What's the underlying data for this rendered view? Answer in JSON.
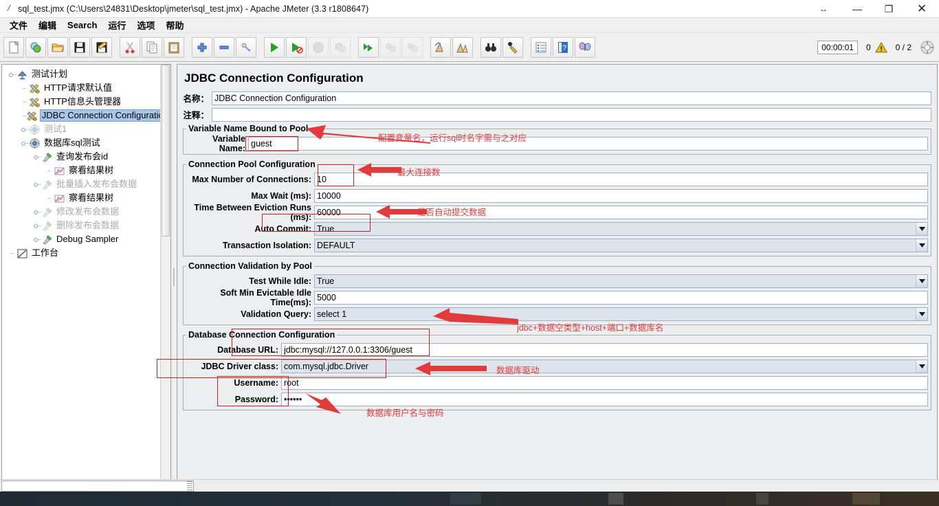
{
  "window": {
    "title": "sql_test.jmx (C:\\Users\\24831\\Desktop\\jmeter\\sql_test.jmx) - Apache JMeter (3.3 r1808647)",
    "app_icon": "jmeter-feather-icon",
    "controls": {
      "restore_arrows": "↔",
      "minimize": "—",
      "maximize": "❐",
      "close": "✕"
    }
  },
  "menubar": {
    "items": [
      {
        "label": "文件",
        "name": "menu-file"
      },
      {
        "label": "编辑",
        "name": "menu-edit"
      },
      {
        "label": "Search",
        "name": "menu-search"
      },
      {
        "label": "运行",
        "name": "menu-run"
      },
      {
        "label": "选项",
        "name": "menu-options"
      },
      {
        "label": "帮助",
        "name": "menu-help"
      }
    ]
  },
  "toolbar": {
    "buttons": [
      {
        "name": "new-button",
        "icon": "new-document-icon",
        "enabled": true
      },
      {
        "name": "templates-button",
        "icon": "templates-icon",
        "enabled": true
      },
      {
        "name": "open-button",
        "icon": "open-folder-icon",
        "enabled": true
      },
      {
        "name": "save-button",
        "icon": "floppy-save-icon",
        "enabled": true
      },
      {
        "name": "save-as-button",
        "icon": "save-as-icon",
        "enabled": true
      },
      {
        "name": "cut-button",
        "icon": "scissors-icon",
        "enabled": true
      },
      {
        "name": "copy-button",
        "icon": "copy-icon",
        "enabled": true
      },
      {
        "name": "paste-button",
        "icon": "clipboard-paste-icon",
        "enabled": true
      },
      {
        "name": "expand-all-button",
        "icon": "plus-icon",
        "enabled": true
      },
      {
        "name": "collapse-all-button",
        "icon": "minus-icon",
        "enabled": true
      },
      {
        "name": "toggle-button",
        "icon": "toggle-icon",
        "enabled": true
      },
      {
        "name": "start-button",
        "icon": "play-green-icon",
        "enabled": true
      },
      {
        "name": "start-no-pauses-button",
        "icon": "play-no-pause-icon",
        "enabled": true
      },
      {
        "name": "stop-button",
        "icon": "stop-octagon-icon",
        "enabled": false
      },
      {
        "name": "shutdown-button",
        "icon": "shutdown-icon",
        "enabled": false
      },
      {
        "name": "start-remote-button",
        "icon": "remote-start-icon",
        "enabled": true
      },
      {
        "name": "stop-remote-button",
        "icon": "remote-stop-icon",
        "enabled": false
      },
      {
        "name": "shutdown-remote-button",
        "icon": "remote-shutdown-icon",
        "enabled": false
      },
      {
        "name": "clear-button",
        "icon": "clear-broom-icon",
        "enabled": true
      },
      {
        "name": "clear-all-button",
        "icon": "clear-all-icon",
        "enabled": true
      },
      {
        "name": "search-button",
        "icon": "binoculars-icon",
        "enabled": true
      },
      {
        "name": "search-reset-button",
        "icon": "search-reset-icon",
        "enabled": true
      },
      {
        "name": "function-helper-button",
        "icon": "function-list-icon",
        "enabled": true
      },
      {
        "name": "help-button",
        "icon": "help-book-icon",
        "enabled": true
      },
      {
        "name": "undo-redo-button",
        "icon": "butterfly-icon",
        "enabled": true
      }
    ],
    "status": {
      "timer": "00:00:01",
      "error_count": "0",
      "warning_icon": "warning-triangle-icon",
      "threads": "0 / 2",
      "threads_icon": "threads-gear-icon"
    }
  },
  "tree": {
    "nodes": [
      {
        "label": "测试计划",
        "icon": "test-plan-icon",
        "depth": 0,
        "enabled": true,
        "selected": false,
        "expander": "expanded"
      },
      {
        "label": "HTTP请求默认值",
        "icon": "config-tools-icon",
        "depth": 1,
        "enabled": true,
        "selected": false,
        "expander": "none"
      },
      {
        "label": "HTTP信息头管理器",
        "icon": "config-tools-icon",
        "depth": 1,
        "enabled": true,
        "selected": false,
        "expander": "none"
      },
      {
        "label": "JDBC Connection Configuration",
        "icon": "config-tools-icon",
        "depth": 1,
        "enabled": true,
        "selected": true,
        "expander": "none"
      },
      {
        "label": "测试1",
        "icon": "thread-group-icon",
        "depth": 1,
        "enabled": false,
        "selected": false,
        "expander": "collapsed"
      },
      {
        "label": "数据库sql测试",
        "icon": "thread-group-icon",
        "depth": 1,
        "enabled": true,
        "selected": false,
        "expander": "expanded"
      },
      {
        "label": "查询发布会id",
        "icon": "sampler-pipette-icon",
        "depth": 2,
        "enabled": true,
        "selected": false,
        "expander": "expanded"
      },
      {
        "label": "察看结果树",
        "icon": "listener-chart-icon",
        "depth": 3,
        "enabled": true,
        "selected": false,
        "expander": "none"
      },
      {
        "label": "批量插入发布会数据",
        "icon": "sampler-pipette-icon",
        "depth": 2,
        "enabled": false,
        "selected": false,
        "expander": "expanded"
      },
      {
        "label": "察看结果树",
        "icon": "listener-chart-icon",
        "depth": 3,
        "enabled": true,
        "selected": false,
        "expander": "none"
      },
      {
        "label": "修改发布会数据",
        "icon": "sampler-pipette-icon",
        "depth": 2,
        "enabled": false,
        "selected": false,
        "expander": "collapsed"
      },
      {
        "label": "删除发布会数据",
        "icon": "sampler-pipette-icon",
        "depth": 2,
        "enabled": false,
        "selected": false,
        "expander": "collapsed"
      },
      {
        "label": "Debug Sampler",
        "icon": "sampler-pipette-icon",
        "depth": 2,
        "enabled": true,
        "selected": false,
        "expander": "collapsed"
      },
      {
        "label": "工作台",
        "icon": "workbench-icon",
        "depth": 0,
        "enabled": true,
        "selected": false,
        "expander": "none"
      }
    ]
  },
  "form": {
    "title": "JDBC Connection Configuration",
    "name_label": "名称：",
    "name_value": "JDBC Connection Configuration",
    "comment_label": "注释：",
    "comment_value": "",
    "groups": {
      "variable_name_bound": {
        "legend": "Variable Name Bound to Pool",
        "fields": [
          {
            "label": "Variable Name:",
            "value": "guest",
            "type": "text",
            "name": "variable-name-field"
          }
        ]
      },
      "connection_pool": {
        "legend": "Connection Pool Configuration",
        "fields": [
          {
            "label": "Max Number of Connections:",
            "value": "10",
            "type": "text",
            "name": "max-connections-field"
          },
          {
            "label": "Max Wait (ms):",
            "value": "10000",
            "type": "text",
            "name": "max-wait-field"
          },
          {
            "label": "Time Between Eviction Runs (ms):",
            "value": "60000",
            "type": "text",
            "name": "eviction-runs-field"
          },
          {
            "label": "Auto Commit:",
            "value": "True",
            "type": "combo",
            "name": "auto-commit-combo"
          },
          {
            "label": "Transaction Isolation:",
            "value": "DEFAULT",
            "type": "combo",
            "name": "transaction-isolation-combo"
          }
        ]
      },
      "connection_validation": {
        "legend": "Connection Validation by Pool",
        "fields": [
          {
            "label": "Test While Idle:",
            "value": "True",
            "type": "combo",
            "name": "test-while-idle-combo"
          },
          {
            "label": "Soft Min Evictable Idle Time(ms):",
            "value": "5000",
            "type": "text",
            "name": "soft-min-evictable-field"
          },
          {
            "label": "Validation Query:",
            "value": "select 1",
            "type": "combo",
            "name": "validation-query-combo"
          }
        ]
      },
      "database_connection": {
        "legend": "Database Connection Configuration",
        "fields": [
          {
            "label": "Database URL:",
            "value": "jdbc:mysql://127.0.0.1:3306/guest",
            "type": "text",
            "name": "database-url-field"
          },
          {
            "label": "JDBC Driver class:",
            "value": "com.mysql.jdbc.Driver",
            "type": "combo",
            "name": "jdbc-driver-class-combo"
          },
          {
            "label": "Username:",
            "value": "root",
            "type": "text",
            "name": "username-field"
          },
          {
            "label": "Password:",
            "value": "••••••",
            "type": "text",
            "name": "password-field"
          }
        ]
      }
    }
  },
  "annotations": {
    "color": "#e23b3b",
    "items": [
      {
        "name": "annotation-variable-name",
        "text": "配置变量名，运行sql时名字需与之对应"
      },
      {
        "name": "annotation-max-connections",
        "text": "最大连接数"
      },
      {
        "name": "annotation-auto-commit",
        "text": "是否自动提交数据"
      },
      {
        "name": "annotation-database-url",
        "text": "jdbc+数据空类型+host+端口+数据库名"
      },
      {
        "name": "annotation-jdbc-driver",
        "text": "数据库驱动"
      },
      {
        "name": "annotation-credentials",
        "text": "数据库用户名与密码"
      }
    ]
  }
}
